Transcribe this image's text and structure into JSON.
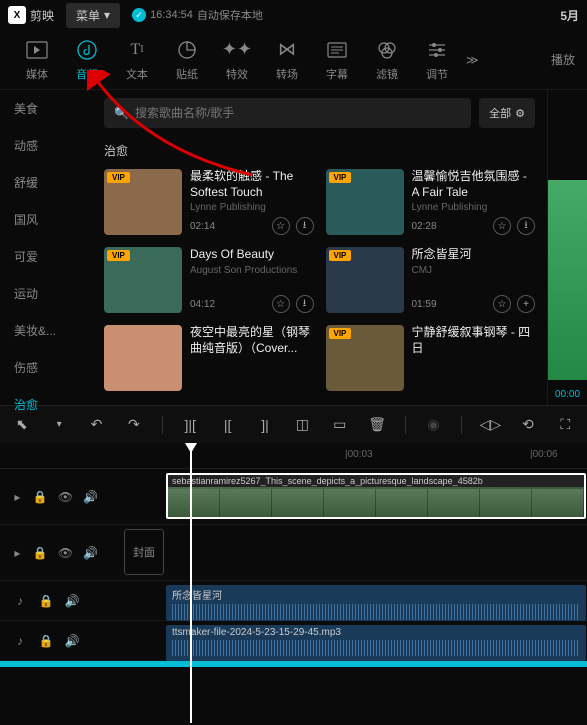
{
  "topbar": {
    "logo": "剪映",
    "menu": "菜单",
    "autosave_time": "16:34:54",
    "autosave_text": "自动保存本地",
    "date": "5月"
  },
  "tabs": [
    {
      "icon": "▶",
      "label": "媒体"
    },
    {
      "icon": "♪",
      "label": "音频"
    },
    {
      "icon": "TI",
      "label": "文本"
    },
    {
      "icon": "◷",
      "label": "贴纸"
    },
    {
      "icon": "✦",
      "label": "特效"
    },
    {
      "icon": "⋈",
      "label": "转场"
    },
    {
      "icon": "▤",
      "label": "字幕"
    },
    {
      "icon": "❀",
      "label": "滤镜"
    },
    {
      "icon": "⚙",
      "label": "调节"
    }
  ],
  "right_tab": "播放",
  "sidebar": {
    "items": [
      "美食",
      "动感",
      "舒缓",
      "国风",
      "可爱",
      "运动",
      "美妆&...",
      "伤感",
      "治愈"
    ]
  },
  "search": {
    "placeholder": "搜索歌曲名称/歌手"
  },
  "filter": {
    "label": "全部"
  },
  "section_title": "治愈",
  "music": [
    {
      "title": "最柔软的触感 - The Softest Touch",
      "artist": "Lynne Publishing",
      "duration": "02:14",
      "thumb": "#8a6a4a",
      "vip": true
    },
    {
      "title": "温馨愉悦吉他氛围感 - A Fair Tale",
      "artist": "Lynne Publishing",
      "duration": "02:28",
      "thumb": "#2a5a5a",
      "vip": true
    },
    {
      "title": "Days Of Beauty",
      "artist": "August Son Productions",
      "duration": "04:12",
      "thumb": "#3a6a5a",
      "vip": true
    },
    {
      "title": "所念皆星河",
      "artist": "CMJ",
      "duration": "01:59",
      "thumb": "#2a3a4a",
      "vip": true
    },
    {
      "title": "夜空中最亮的星（钢琴曲纯音版）（Cover...",
      "artist": "",
      "duration": "",
      "thumb": "#c89070",
      "vip": false
    },
    {
      "title": "宁静舒缓叙事钢琴 - 四日",
      "artist": "",
      "duration": "",
      "thumb": "#6a5a3a",
      "vip": true
    }
  ],
  "preview": {
    "time": "00:00"
  },
  "ruler": [
    {
      "pos": 170,
      "label": ""
    },
    {
      "pos": 345,
      "label": "|00:03"
    },
    {
      "pos": 530,
      "label": "|00:06"
    }
  ],
  "video_clip": {
    "label": "sebastianramirez5267_This_scene_depicts_a_picturesque_landscape_4582b"
  },
  "cover_label": "封面",
  "audio1": {
    "label": "所念皆星河"
  },
  "audio2": {
    "label": "ttsmaker-file-2024-5-23-15-29-45.mp3"
  }
}
